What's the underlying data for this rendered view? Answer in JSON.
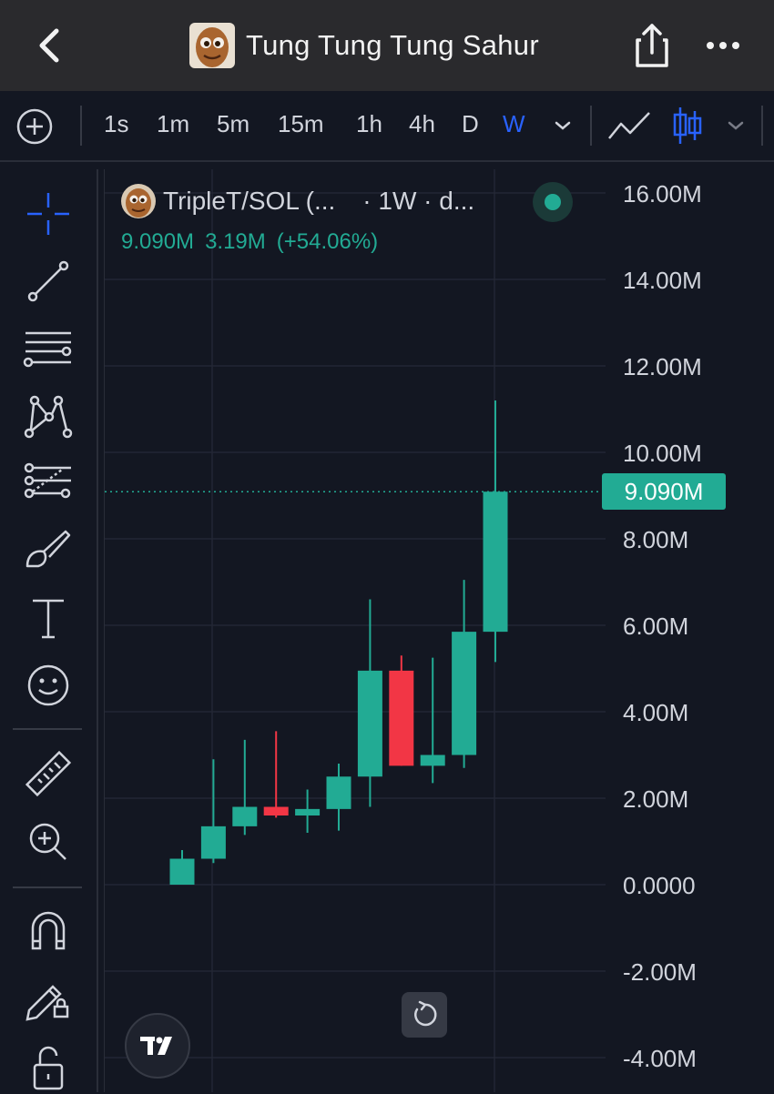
{
  "header": {
    "title": "Tung Tung Tung Sahur"
  },
  "toolbar": {
    "timeframes": [
      "1s",
      "1m",
      "5m",
      "15m",
      "1h",
      "4h",
      "D",
      "W"
    ],
    "active_timeframe": "W"
  },
  "legend": {
    "symbol_text": "TripleT/SOL (...",
    "interval_text": "· 1W · d...",
    "price": "9.090M",
    "change": "3.19M",
    "change_pct": "(+54.06%)"
  },
  "price_tag": "9.090M",
  "colors": {
    "up": "#22ab94",
    "down": "#f23645",
    "accent": "#2962ff",
    "background": "#131722"
  },
  "chart_data": {
    "type": "candlestick",
    "ylim": [
      -4000000,
      16000000
    ],
    "y_ticks": [
      "16.00M",
      "14.00M",
      "12.00M",
      "10.00M",
      "8.00M",
      "6.00M",
      "4.00M",
      "2.00M",
      "0.0000",
      "-2.00M",
      "-4.00M"
    ],
    "y_tick_values": [
      16000000,
      14000000,
      12000000,
      10000000,
      8000000,
      6000000,
      4000000,
      2000000,
      0,
      -2000000,
      -4000000
    ],
    "last_price": 9090000,
    "candles": [
      {
        "o": 0.0,
        "h": 0.8,
        "l": 0.0,
        "c": 0.6
      },
      {
        "o": 0.6,
        "h": 2.9,
        "l": 0.5,
        "c": 1.35
      },
      {
        "o": 1.35,
        "h": 3.35,
        "l": 1.15,
        "c": 1.8
      },
      {
        "o": 1.8,
        "h": 3.55,
        "l": 1.55,
        "c": 1.6
      },
      {
        "o": 1.6,
        "h": 2.2,
        "l": 1.2,
        "c": 1.75
      },
      {
        "o": 1.75,
        "h": 2.8,
        "l": 1.25,
        "c": 2.5
      },
      {
        "o": 2.5,
        "h": 6.6,
        "l": 1.8,
        "c": 4.95
      },
      {
        "o": 4.95,
        "h": 5.3,
        "l": 2.75,
        "c": 2.75
      },
      {
        "o": 2.75,
        "h": 5.25,
        "l": 2.35,
        "c": 3.0
      },
      {
        "o": 3.0,
        "h": 7.05,
        "l": 2.7,
        "c": 5.85
      },
      {
        "o": 5.85,
        "h": 11.2,
        "l": 5.15,
        "c": 9.09
      }
    ],
    "unit": "M"
  }
}
